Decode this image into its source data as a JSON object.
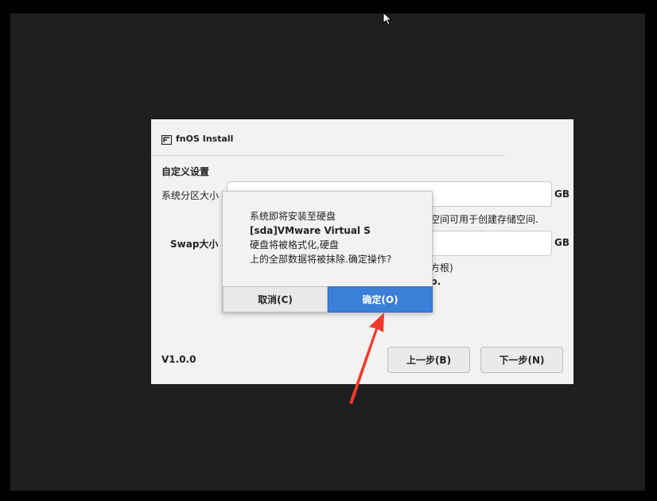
{
  "window": {
    "title": "fnOS Install",
    "section_title": "自定义设置",
    "system_partition_label": "系统分区大小",
    "system_partition_unit": "GB",
    "system_partition_hint": "空间可用于创建存储空间.",
    "swap_label": "Swap大小",
    "swap_unit": "GB",
    "swap_hint_1": "方根)",
    "swap_hint_2": "p.",
    "version": "V1.0.0",
    "prev_button": "上一步(B)",
    "next_button": "下一步(N)"
  },
  "dialog": {
    "line1": "系统即将安装至硬盘",
    "line2": "[sda]VMware Virtual S",
    "line3": "硬盘将被格式化,硬盘",
    "line4": "上的全部数据将被抹除.确定操作?",
    "cancel_label": "取消(C)",
    "ok_label": "确定(O)"
  },
  "colors": {
    "accent": "#3b7fd9",
    "annotation_arrow": "#f03a2e",
    "background": "#1f1f21"
  }
}
